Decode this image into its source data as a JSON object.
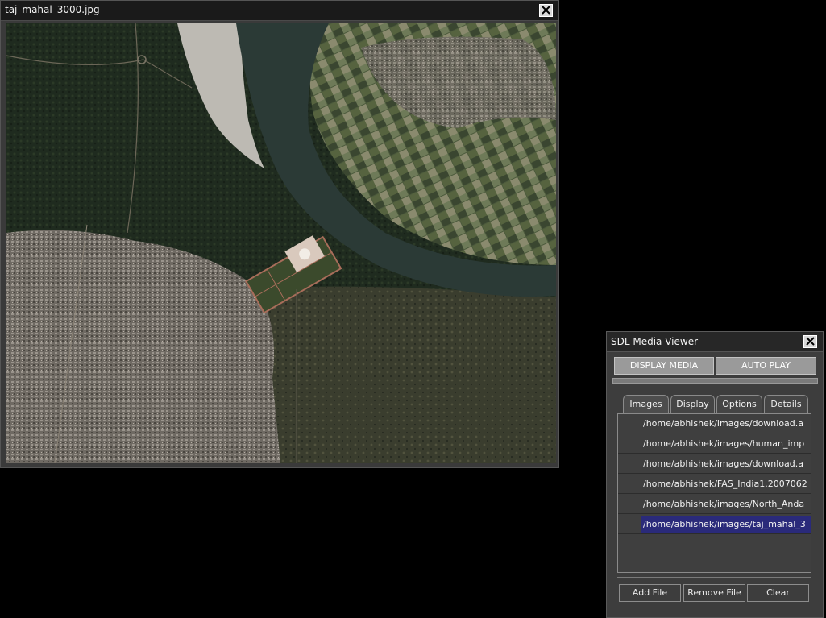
{
  "image_window": {
    "title": "taj_mahal_3000.jpg",
    "close_icon": "close-icon"
  },
  "media_viewer": {
    "title": "SDL Media Viewer",
    "close_icon": "close-icon",
    "display_media_label": "DISPLAY MEDIA",
    "auto_play_label": "AUTO PLAY",
    "tabs": [
      {
        "label": "Images",
        "active": true
      },
      {
        "label": "Display",
        "active": false
      },
      {
        "label": "Options",
        "active": false
      },
      {
        "label": "Details",
        "active": false
      }
    ],
    "files": [
      {
        "path": "/home/abhishek/images/download.a",
        "selected": false
      },
      {
        "path": "/home/abhishek/images/human_imp",
        "selected": false
      },
      {
        "path": "/home/abhishek/images/download.a",
        "selected": false
      },
      {
        "path": "/home/abhishek/FAS_India1.2007062",
        "selected": false
      },
      {
        "path": "/home/abhishek/images/North_Anda",
        "selected": false
      },
      {
        "path": "/home/abhishek/images/taj_mahal_3",
        "selected": true
      }
    ],
    "add_file_label": "Add File",
    "remove_file_label": "Remove File",
    "clear_label": "Clear"
  },
  "colors": {
    "selection": "#2a2a7a",
    "button_gray": "#9a9a9a",
    "river": "#2b3a36"
  }
}
